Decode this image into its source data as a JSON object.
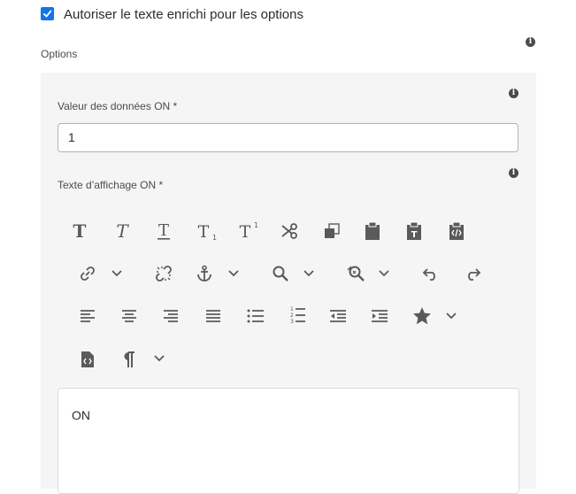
{
  "rich_text_option": {
    "checked": true,
    "label": "Autoriser le texte enrichi pour les options"
  },
  "options_section": {
    "label": "Options"
  },
  "on_value": {
    "label": "Valeur des données ON *",
    "value": "1"
  },
  "display_text": {
    "label": "Texte d’affichage ON *",
    "content": "ON"
  },
  "toolbar": {
    "rows": [
      [
        "bold-icon",
        "italic-icon",
        "underline-icon",
        "subscript-icon",
        "superscript-icon",
        "cut-icon",
        "copy-icon",
        "paste-icon",
        "paste-text-icon",
        "paste-html-icon"
      ],
      [
        "link-icon",
        "chevron-down-icon",
        "unlink-icon",
        "anchor-icon",
        "chevron-down-icon",
        "find-icon",
        "chevron-down-icon",
        "find-replace-icon",
        "chevron-down-icon",
        "undo-icon",
        "redo-icon"
      ],
      [
        "align-left-icon",
        "align-center-icon",
        "align-right-icon",
        "justify-icon",
        "bulleted-list-icon",
        "numbered-list-icon",
        "outdent-icon",
        "indent-icon",
        "star-icon",
        "chevron-down-icon"
      ],
      [
        "source-edit-icon",
        "paragraph-icon",
        "chevron-down-icon"
      ]
    ]
  },
  "colors": {
    "accent": "#1473e6",
    "panel_bg": "#f5f5f5",
    "icon": "#5a5a5a"
  }
}
